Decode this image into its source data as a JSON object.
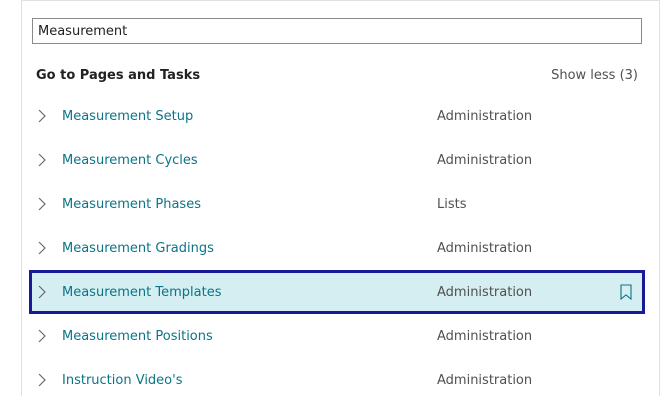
{
  "search": {
    "value": "Measurement"
  },
  "section": {
    "title": "Go to Pages and Tasks",
    "show_less_label": "Show less (3)"
  },
  "results": [
    {
      "name": "Measurement Setup",
      "category": "Administration"
    },
    {
      "name": "Measurement Cycles",
      "category": "Administration"
    },
    {
      "name": "Measurement Phases",
      "category": "Lists"
    },
    {
      "name": "Measurement Gradings",
      "category": "Administration"
    },
    {
      "name": "Measurement Templates",
      "category": "Administration"
    },
    {
      "name": "Measurement Positions",
      "category": "Administration"
    },
    {
      "name": "Instruction Video's",
      "category": "Administration"
    }
  ],
  "selected_index": 4,
  "colors": {
    "link": "#0b7487",
    "selected_bg": "#d4eef1",
    "selected_border": "#1a1a96"
  }
}
